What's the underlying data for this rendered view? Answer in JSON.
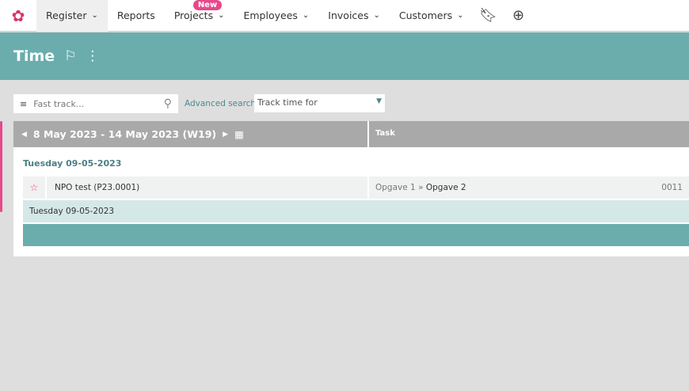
{
  "nav": {
    "items": [
      {
        "label": "Register"
      },
      {
        "label": "Reports"
      },
      {
        "label": "Projects",
        "badge": "New"
      },
      {
        "label": "Employees"
      },
      {
        "label": "Invoices"
      },
      {
        "label": "Customers"
      }
    ]
  },
  "header": {
    "title": "Time"
  },
  "toolbar": {
    "search_placeholder": "Fast track...",
    "advanced_search": "Advanced search",
    "track_for": "Track time for"
  },
  "week": {
    "range": "8 May 2023 - 14 May 2023 (W19)",
    "task_header": "Task"
  },
  "entries": {
    "day": "Tuesday 09-05-2023",
    "project": "NPO test (P23.0001)",
    "task_parent": "Opgave 1",
    "sep": " » ",
    "task": "Opgave 2",
    "code": "0011",
    "day_row": "Tuesday 09-05-2023"
  }
}
